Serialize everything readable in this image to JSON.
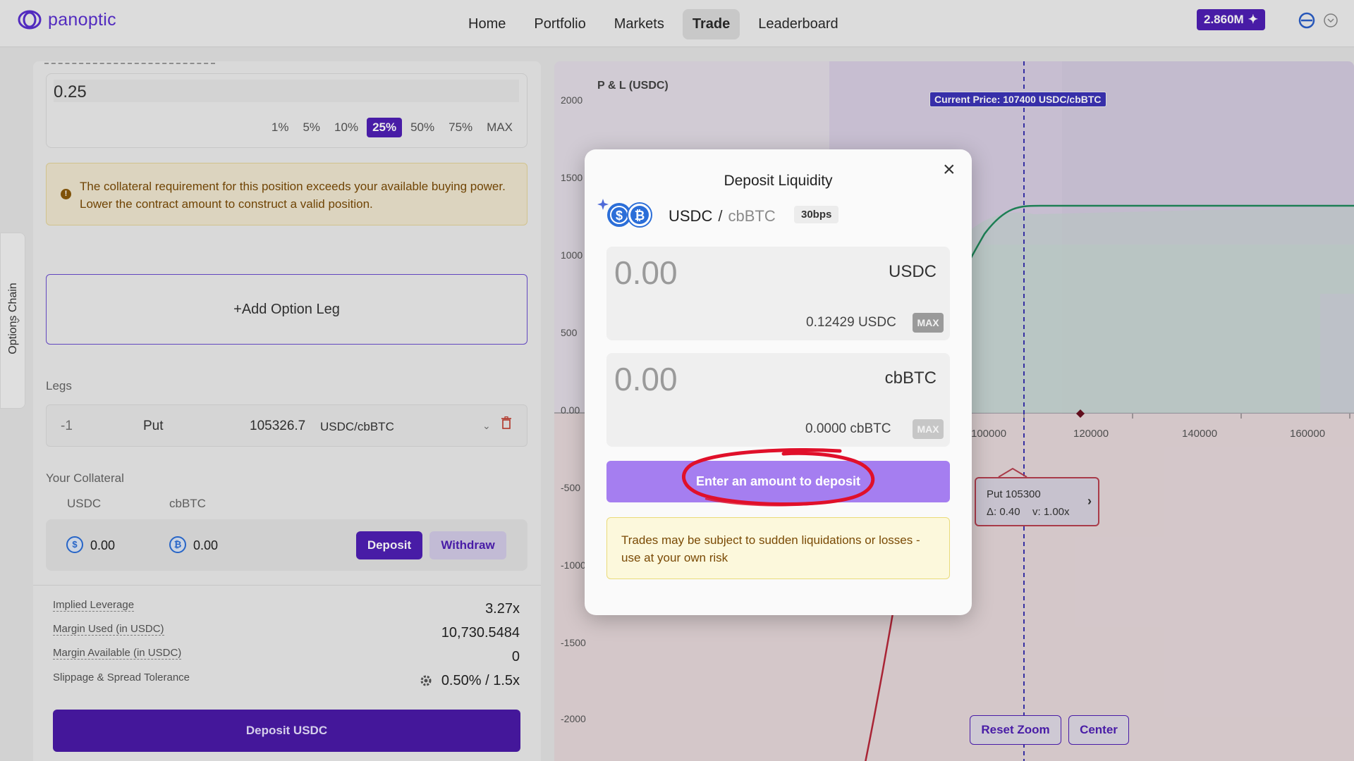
{
  "brand": {
    "name": "panoptic",
    "color": "#5a2fd0",
    "icon": "panoptic-logo-icon"
  },
  "nav": {
    "items": [
      {
        "label": "Home"
      },
      {
        "label": "Portfolio"
      },
      {
        "label": "Markets"
      },
      {
        "label": "Trade",
        "active": true
      },
      {
        "label": "Leaderboard"
      }
    ]
  },
  "header": {
    "points_label": "2.860M",
    "points_icon": "sparkle-icon"
  },
  "trade_form": {
    "amount_value": "0.25",
    "percent_options": [
      "1%",
      "5%",
      "10%",
      "25%",
      "50%",
      "75%",
      "MAX"
    ],
    "selected_percent": "25%",
    "warning_text": "The collateral requirement for this position exceeds your available buying power. Lower the contract amount to construct a valid position.",
    "add_leg_label": "+Add Option Leg",
    "legs_label": "Legs",
    "leg": {
      "qty": "-1",
      "type": "Put",
      "strike": "105326.7",
      "pair": "USDC/cbBTC"
    },
    "collateral_label": "Your Collateral",
    "collateral": {
      "token1_label": "USDC",
      "token1_value": "0.00",
      "token2_label": "cbBTC",
      "token2_value": "0.00",
      "deposit_label": "Deposit",
      "withdraw_label": "Withdraw"
    },
    "stats": [
      {
        "label": "Implied Leverage",
        "value": "3.27x"
      },
      {
        "label": "Margin Used (in USDC)",
        "value": "10,730.5484"
      },
      {
        "label": "Margin Available (in USDC)",
        "value": "0"
      },
      {
        "label": "Slippage & Spread Tolerance",
        "value": "0.50% / 1.5x"
      }
    ],
    "primary_button": "Deposit USDC"
  },
  "side_tab": {
    "label": "Options Chain"
  },
  "chart": {
    "title": "P & L (USDC)",
    "current_price_label": "Current Price: 107400 USDC/cbBTC",
    "y_ticks": [
      "2000",
      "1500",
      "1000",
      "500",
      "0.00",
      "-500",
      "-1000",
      "-1500",
      "-2000"
    ],
    "x_ticks": [
      "100000",
      "120000",
      "140000",
      "160000"
    ],
    "tooltip": {
      "title": "Put 105300",
      "delta": "Δ: 0.40",
      "vol": "v: 1.00x"
    },
    "reset_zoom_label": "Reset Zoom",
    "center_label": "Center"
  },
  "modal": {
    "title": "Deposit Liquidity",
    "base_token": "USDC",
    "quote_token": "cbBTC",
    "fee_tier": "30bps",
    "input1": {
      "value": "0.00",
      "token": "USDC",
      "balance": "0.12429 USDC",
      "max_label": "MAX"
    },
    "input2": {
      "value": "0.00",
      "token": "cbBTC",
      "balance": "0.0000 cbBTC",
      "max_label": "MAX"
    },
    "submit_label": "Enter an amount to deposit",
    "risk_text": "Trades may be subject to sudden liquidations or losses - use at your own risk"
  }
}
